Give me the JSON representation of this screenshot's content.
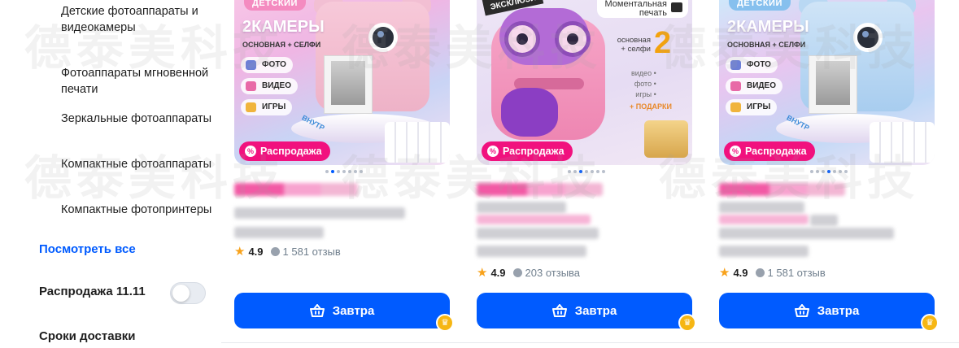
{
  "sidebar": {
    "categories": [
      "Детские фотоаппараты и видеокамеры",
      "Фотоаппараты мгновенной печати",
      "Зеркальные фотоаппараты",
      "Компактные фотоаппараты",
      "Компактные фотопринтеры"
    ],
    "see_all": "Посмотреть все",
    "sale_filter": {
      "label": "Распродажа 11.11",
      "enabled": false
    },
    "delivery_title": "Сроки доставки"
  },
  "watermark": "德泰美科技",
  "colors": {
    "accent": "#005bff",
    "sale": "#f1117e",
    "star": "#f8a21b",
    "crown": "#f6b613"
  },
  "products": [
    {
      "image": {
        "top_tag": "ДЕТСКИЙ",
        "headline": "2КАМЕРЫ",
        "subline": "ОСНОВНАЯ + СЕЛФИ",
        "features": [
          "ФОТО",
          "ВИДЕО",
          "ИГРЫ"
        ],
        "corner_text": "ВНУТР",
        "theme": "pink"
      },
      "badge": "Распродажа",
      "dots": {
        "count": 7,
        "active_index": 1
      },
      "rating": "4.9",
      "reviews": "1 581 отзыв",
      "button": "Завтра",
      "icons": {
        "cart": "basket-icon",
        "badge": "crown-icon"
      }
    },
    {
      "image": {
        "top_tag": "ЭКСКЛЮЗИ",
        "instant_print": "Моментальная печать",
        "big_number": "2",
        "side_text": "основная + селфи",
        "side_list": [
          "видео •",
          "фото •",
          "игры •"
        ],
        "gifts": "+ ПОДАРКИ",
        "theme": "dino"
      },
      "badge": "Распродажа",
      "dots": {
        "count": 7,
        "active_index": 2
      },
      "rating": "4.9",
      "reviews": "203 отзыва",
      "button": "Завтра",
      "icons": {
        "cart": "basket-icon",
        "badge": "crown-icon"
      }
    },
    {
      "image": {
        "top_tag": "ДЕТСКИЙ",
        "headline": "2КАМЕРЫ",
        "subline": "ОСНОВНАЯ + СЕЛФИ",
        "features": [
          "ФОТО",
          "ВИДЕО",
          "ИГРЫ"
        ],
        "corner_text": "ВНУТР",
        "theme": "blue"
      },
      "badge": "Распродажа",
      "dots": {
        "count": 7,
        "active_index": 3
      },
      "rating": "4.9",
      "reviews": "1 581 отзыв",
      "button": "Завтра",
      "icons": {
        "cart": "basket-icon",
        "badge": "crown-icon"
      }
    }
  ]
}
